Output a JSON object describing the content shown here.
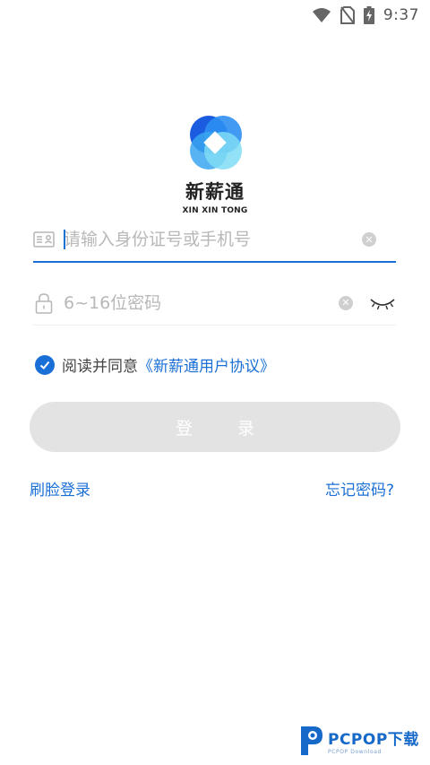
{
  "status_bar": {
    "time": "9:37",
    "icons": [
      "wifi-icon",
      "no-sim-icon",
      "battery-charging-icon"
    ]
  },
  "app": {
    "name": "新薪通",
    "name_pinyin": "XIN XIN TONG"
  },
  "form": {
    "id_placeholder": "请输入身份证号或手机号",
    "password_placeholder": "6~16位密码",
    "agree_text": "阅读并同意",
    "agreement_link": "《新薪通用户协议》",
    "login_label": "登 录"
  },
  "links": {
    "face_login": "刷脸登录",
    "forgot_password": "忘记密码?"
  },
  "watermark": {
    "brand": "PCPOP下载",
    "sub": "PCPOP Download"
  },
  "colors": {
    "accent": "#1a6fd6",
    "button_disabled": "#e3e3e3",
    "placeholder": "#b8b8b8"
  }
}
